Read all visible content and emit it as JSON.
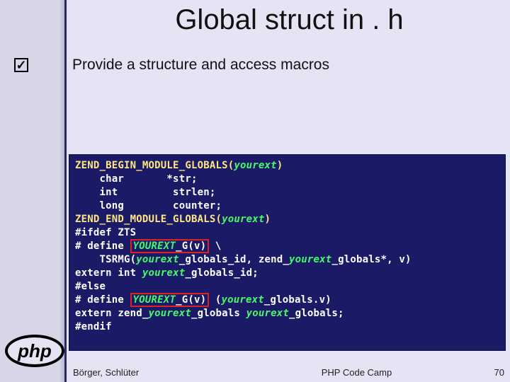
{
  "title": "Global struct in . h",
  "bullet": {
    "check_glyph": "✓",
    "text": "Provide a structure and access macros"
  },
  "code": {
    "line1_a": "ZEND_BEGIN_MODULE_GLOBALS(",
    "line1_b": "yourext",
    "line1_c": ")",
    "line2": "    char       *str;",
    "line3": "    int         strlen;",
    "line4": "    long        counter;",
    "line5_a": "ZEND_END_MODULE_GLOBALS(",
    "line5_b": "yourext",
    "line5_c": ")",
    "line6": "#ifdef ZTS",
    "line7_a": "# define ",
    "line7_b1": "YOUREXT",
    "line7_b2": "_G(v)",
    "line7_c": " \\",
    "line8_a": "    TSRMG(",
    "line8_b": "yourext",
    "line8_c": "_globals_id, zend_",
    "line8_d": "yourext",
    "line8_e": "_globals*, v)",
    "line9_a": "extern int ",
    "line9_b": "yourext",
    "line9_c": "_globals_id;",
    "line10": "#else",
    "line11_a": "# define ",
    "line11_b1": "YOUREXT",
    "line11_b2": "_G(v)",
    "line11_c": " (",
    "line11_d": "yourext",
    "line11_e": "_globals.v)",
    "line12_a": "extern zend_",
    "line12_b": "yourext",
    "line12_c": "_globals ",
    "line12_d": "yourext",
    "line12_e": "_globals;",
    "line13": "#endif"
  },
  "footer": {
    "authors": "Börger, Schlüter",
    "center": "PHP Code Camp",
    "page": "70"
  },
  "logo_text": "php"
}
